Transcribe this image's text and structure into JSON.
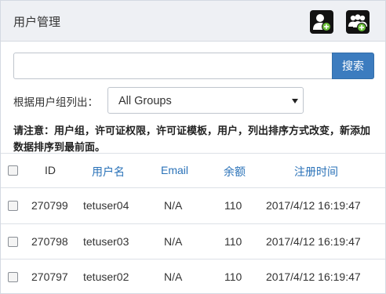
{
  "header": {
    "title": "用户管理",
    "add_user_icon": "add-user-icon",
    "add_group_icon": "add-user-group-icon"
  },
  "search": {
    "value": "",
    "placeholder": "",
    "button_label": "搜索"
  },
  "group_filter": {
    "label": "根据用户组列出：",
    "selected": "All Groups"
  },
  "notice": "请注意：用户组，许可证权限，许可证模板，用户，列出排序方式改变，新添加数据排序到最前面。",
  "table": {
    "columns": [
      "ID",
      "用户名",
      "Email",
      "余额",
      "注册时间"
    ],
    "rows": [
      {
        "id": "270799",
        "username": "tetuser04",
        "email": "N/A",
        "balance": "110",
        "registered": "2017/4/12 16:19:47"
      },
      {
        "id": "270798",
        "username": "tetuser03",
        "email": "N/A",
        "balance": "110",
        "registered": "2017/4/12 16:19:47"
      },
      {
        "id": "270797",
        "username": "tetuser02",
        "email": "N/A",
        "balance": "110",
        "registered": "2017/4/12 16:19:47"
      }
    ]
  },
  "colors": {
    "accent": "#3c7cbf",
    "link": "#2a72b8",
    "header_bg": "#eef0f4",
    "icon_badge": "#6bbf3a"
  }
}
